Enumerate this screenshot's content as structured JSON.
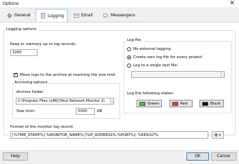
{
  "window": {
    "title": "Options"
  },
  "tabs": [
    {
      "label": "General",
      "icon": "gear-icon",
      "active": false
    },
    {
      "label": "Logging",
      "icon": "logging-icon",
      "active": true
    },
    {
      "label": "Email",
      "icon": "email-icon",
      "active": false
    },
    {
      "label": "Messengers",
      "icon": "messengers-icon",
      "active": false
    }
  ],
  "logging_options": {
    "group_label": "Logging options",
    "keep_label": "Keep in memory up to log records:",
    "keep_value": "1000",
    "move_checkbox_label": "Move logs to the archive at reaching the size limit",
    "move_checked": true,
    "archiving": {
      "group_label": "Archiving options",
      "folder_label": "Archive folder:",
      "folder_value": "C:\\Program Files (x86)\\Total Network Monitor 2\\",
      "size_label": "Size limit:",
      "size_value": "5000",
      "size_unit": "KB"
    }
  },
  "log_file": {
    "group_label": "Log file",
    "options": [
      {
        "label": "No external logging",
        "selected": false
      },
      {
        "label": "Create own log file for every project",
        "selected": true
      },
      {
        "label": "Log to a single text file:",
        "selected": false
      }
    ],
    "file_value": "",
    "states_label": "Log the following states:",
    "states": [
      {
        "label": "Green",
        "color": "#3cc24a"
      },
      {
        "label": "Red",
        "color": "#e33b3b"
      },
      {
        "label": "Black",
        "color": "#111111"
      }
    ]
  },
  "format": {
    "label": "Format of the monitor log record:",
    "value": "[%TIME_STAMP%] %MONITOR_NAME% [%IP_ADDRESS%:%PORT%]: %RESULT%"
  },
  "buttons": {
    "help": "Help",
    "ok": "OK",
    "cancel": "Cancel"
  }
}
